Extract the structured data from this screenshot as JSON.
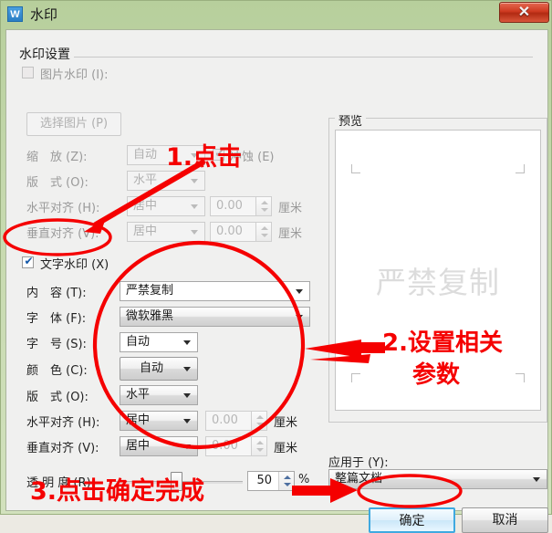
{
  "window": {
    "title": "水印",
    "icon": "wps-writer-icon",
    "close_label": "✕"
  },
  "group": {
    "title": "水印设置"
  },
  "image_watermark": {
    "checkbox_label": "图片水印 (I):",
    "checked": false,
    "enabled": false,
    "select_picture_button": "选择图片 (P)",
    "rows": [
      {
        "label": "缩　放 (Z):",
        "value": "自动"
      },
      {
        "label": "版　式 (O):",
        "value": "水平"
      },
      {
        "label": "水平对齐 (H):",
        "value": "居中",
        "offset": "0.00",
        "unit": "厘米"
      },
      {
        "label": "垂直对齐 (V):",
        "value": "居中",
        "offset": "0.00",
        "unit": "厘米"
      }
    ],
    "washout_label": "冲蚀 (E)",
    "washout_checked": true
  },
  "text_watermark": {
    "checkbox_label": "文字水印 (X)",
    "checked": true,
    "rows": [
      {
        "label": "内　容 (T):",
        "value": "严禁复制"
      },
      {
        "label": "字　体 (F):",
        "value": "微软雅黑"
      },
      {
        "label": "字　号 (S):",
        "value": "自动"
      },
      {
        "label": "颜　色 (C):",
        "value": "自动"
      },
      {
        "label": "版　式 (O):",
        "value": "水平"
      },
      {
        "label": "水平对齐 (H):",
        "value": "居中",
        "offset": "0.00",
        "unit": "厘米"
      },
      {
        "label": "垂直对齐 (V):",
        "value": "居中",
        "offset": "0.00",
        "unit": "厘米"
      }
    ],
    "transparency_label": "透 明 度 (R):",
    "transparency_value": "50",
    "transparency_unit": "%"
  },
  "preview": {
    "title": "预览",
    "watermark_text": "严禁复制"
  },
  "apply_to": {
    "label": "应用于 (Y):",
    "value": "整篇文档"
  },
  "buttons": {
    "ok": "确定",
    "cancel": "取消"
  },
  "annotations": {
    "step1": "1.点击",
    "step2_line1": "2.设置相关",
    "step2_line2": "参数",
    "step3": "3.点击确定完成",
    "color": "#f50000"
  }
}
